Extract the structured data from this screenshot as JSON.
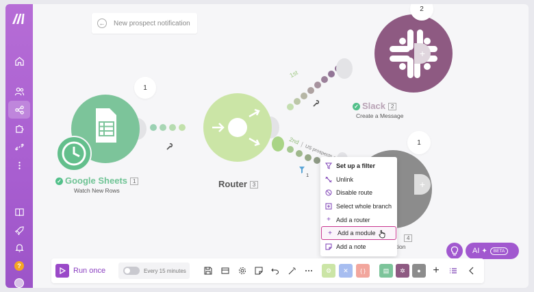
{
  "notification": {
    "label": "New prospect notification"
  },
  "modules": {
    "sheets": {
      "title": "Google Sheets",
      "number": "1",
      "subtitle": "Watch New Rows",
      "bubble": "1",
      "color": "#7cc49a"
    },
    "router": {
      "title": "Router",
      "number": "3",
      "color": "#cbe5a6"
    },
    "slack": {
      "title": "Slack",
      "number": "2",
      "subtitle": "Create a Message",
      "bubble": "2",
      "color": "#8e5a82"
    },
    "fourth": {
      "number": "4",
      "subtitle_partial": "ation",
      "bubble": "1"
    }
  },
  "routes": {
    "first": {
      "label": "1st"
    },
    "second": {
      "label": "2nd",
      "filter": "US prospects only",
      "count": "1"
    }
  },
  "context_menu": {
    "items": [
      {
        "label": "Set up a filter",
        "icon": "filter-icon"
      },
      {
        "label": "Unlink",
        "icon": "unlink-icon"
      },
      {
        "label": "Disable route",
        "icon": "disable-icon"
      },
      {
        "label": "Select whole branch",
        "icon": "branch-icon"
      },
      {
        "label": "Add a router",
        "icon": "plus-icon"
      },
      {
        "label": "Add a module",
        "icon": "plus-icon"
      },
      {
        "label": "Add a note",
        "icon": "note-icon"
      }
    ]
  },
  "toolbar": {
    "run_label": "Run once",
    "schedule_label": "Every 15 minutes"
  },
  "ai": {
    "label": "AI",
    "badge": "BETA"
  },
  "colors": {
    "accent": "#9a49c8",
    "sidebar": "#b066d4",
    "hover_border": "#c8358f"
  }
}
